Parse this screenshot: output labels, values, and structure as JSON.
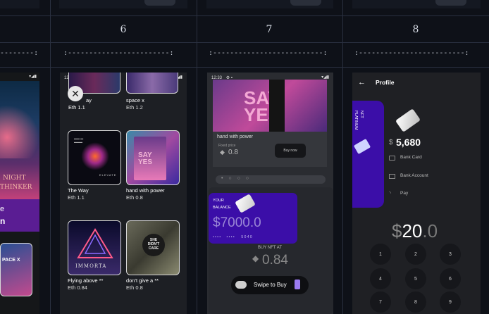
{
  "columns": [
    {
      "number": "6"
    },
    {
      "number": "7"
    },
    {
      "number": "8"
    }
  ],
  "dash_rows": {
    "col5": "--------:",
    "col6": ":------------------------:",
    "col7": ":--------------------------:",
    "col8": ":-------------------------:"
  },
  "screen5": {
    "poster_line1": "NIGHT",
    "poster_line2": "THINKER",
    "banner_line1": "e",
    "banner_line2": "n",
    "thumb_text": "PACE X"
  },
  "screen6": {
    "time": "12:34",
    "top_items": [
      {
        "title": "The Way",
        "price": "Eth 1.1"
      },
      {
        "title": "space x",
        "price": "Eth 1.2"
      }
    ],
    "items": [
      {
        "title": "The Way",
        "price": "Eth 1.1",
        "art": "ELEVATE"
      },
      {
        "title": "hand with power",
        "price": "Eth 0.8",
        "art": "SAY YES"
      },
      {
        "title": "Flying above **",
        "price": "Eth 0.84",
        "art": "IMMORTA"
      },
      {
        "title": "don't give a **",
        "price": "Eth 0.8",
        "art": "SHE DIDN'T CARE"
      }
    ]
  },
  "screen7": {
    "time": "12:33",
    "hero_text": "SAY YES",
    "title": "hand with power",
    "fixed_price_label": "Fixed price",
    "price": "0.8",
    "buy_now": "Buy now",
    "your": "YOUR",
    "balance_label": "BALANCE",
    "balance": "$7000.0",
    "card_dots": "• • • •      • • • •       5 0 4 0",
    "buy_nft_at": "BUY NFT AT",
    "buy_price": "0.84",
    "swipe": "Swipe to Buy",
    "search_dots": "• ○ ○ ○"
  },
  "screen8": {
    "title": "Profile",
    "card_label1": "NFT",
    "card_label2": "PLATINUM",
    "balance": "5,680",
    "menu": [
      {
        "label": "Bank Card",
        "icon": "card-icon"
      },
      {
        "label": "Bank Account",
        "icon": "bank-icon"
      },
      {
        "label": "Pay",
        "icon": "rss-icon"
      }
    ],
    "amount_main": "20",
    "amount_dec": ".0",
    "keys": [
      "1",
      "2",
      "3",
      "4",
      "5",
      "6",
      "7",
      "8",
      "9"
    ]
  },
  "colors": {
    "purple": "#3b0ea8",
    "panel": "#1d1f24",
    "grid": "#2a3040"
  }
}
